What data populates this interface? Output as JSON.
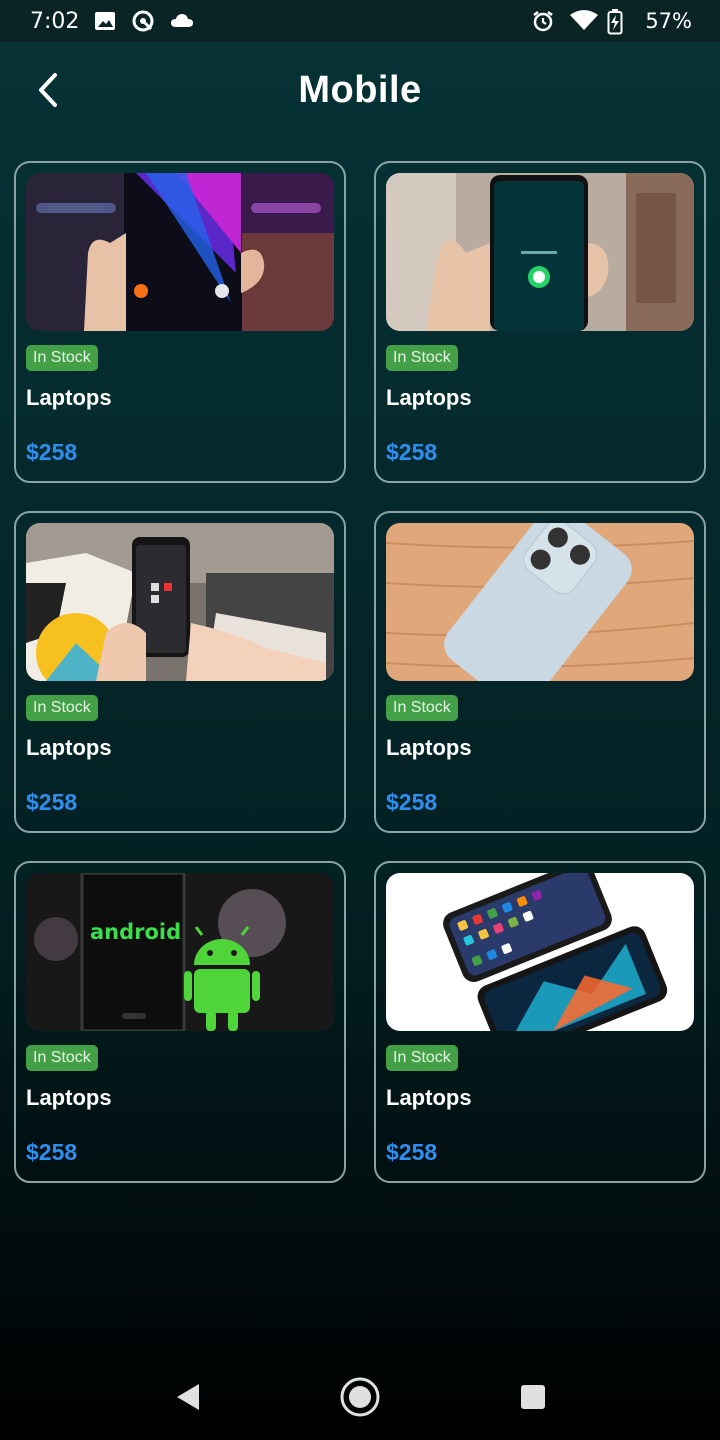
{
  "status_bar": {
    "time": "7:02",
    "battery_percent": "57%",
    "icons_left": [
      "image-icon",
      "sync-icon",
      "cloud-icon"
    ],
    "icons_right": [
      "alarm-icon",
      "wifi-icon",
      "battery-charging-icon"
    ]
  },
  "header": {
    "title": "Mobile",
    "back_icon": "chevron-left-icon"
  },
  "products": [
    {
      "image": "phone-in-hand-purple-wallpaper",
      "badge": "In Stock",
      "name": "Laptops",
      "price": "$258"
    },
    {
      "image": "phone-in-hand-whatsapp",
      "badge": "In Stock",
      "name": "Laptops",
      "price": "$258"
    },
    {
      "image": "phone-held-on-couch",
      "badge": "In Stock",
      "name": "Laptops",
      "price": "$258"
    },
    {
      "image": "white-iphone-on-wood",
      "badge": "In Stock",
      "name": "Laptops",
      "price": "$258"
    },
    {
      "image": "android-logo-and-robot",
      "badge": "In Stock",
      "name": "Laptops",
      "price": "$258"
    },
    {
      "image": "two-smartphones-on-white",
      "badge": "In Stock",
      "name": "Laptops",
      "price": "$258"
    }
  ],
  "colors": {
    "badge_bg": "#43a047",
    "price": "#2f8ff0",
    "card_border": "#8aa4a6"
  },
  "nav_bar": {
    "icons": [
      "back-triangle-icon",
      "home-circle-icon",
      "recents-square-icon"
    ]
  }
}
